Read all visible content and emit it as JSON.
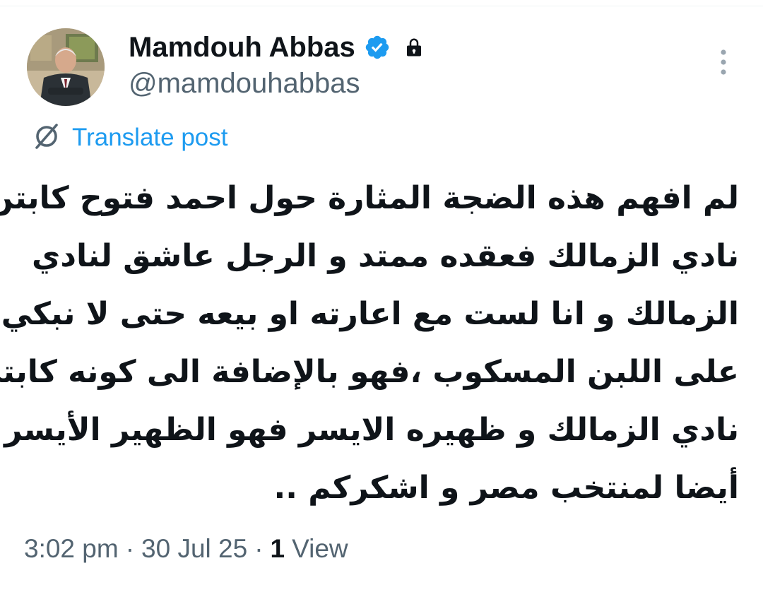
{
  "author": {
    "display_name": "Mamdouh Abbas",
    "handle": "@mamdouhabbas",
    "verified_icon": "verified-badge-icon",
    "lock_icon": "lock-icon"
  },
  "more_icon": "more-vertical-icon",
  "translate": {
    "label": "Translate post",
    "icon": "translate-globe-icon"
  },
  "post": {
    "lines": [
      "لم افهم هذه الضجة المثارة حول احمد فتوح كابتن",
      "نادي الزمالك فعقده ممتد و الرجل عاشق لنادي",
      "الزمالك و انا لست مع اعارته او بيعه حتى لا نبكي",
      "على اللبن المسكوب ،فهو بالإضافة الى كونه كابتن",
      "نادي الزمالك و ظهيره الايسر فهو الظهير الأيسر",
      "أيضا لمنتخب مصر و اشكركم .."
    ]
  },
  "meta": {
    "time": "3:02 pm",
    "separator": "·",
    "date": "30 Jul 25",
    "views_count": "1",
    "views_label": "View"
  },
  "colors": {
    "accent": "#1d9bf0",
    "text_primary": "#0f1419",
    "text_secondary": "#536471"
  }
}
